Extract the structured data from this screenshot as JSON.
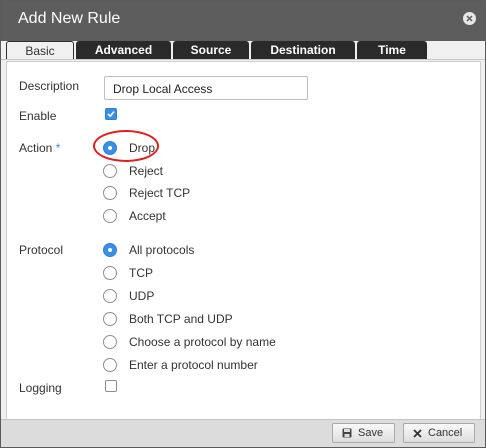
{
  "dialog": {
    "title": "Add New Rule"
  },
  "tabs": [
    {
      "label": "Basic",
      "active": true
    },
    {
      "label": "Advanced",
      "active": false
    },
    {
      "label": "Source",
      "active": false
    },
    {
      "label": "Destination",
      "active": false
    },
    {
      "label": "Time",
      "active": false
    }
  ],
  "form": {
    "description": {
      "label": "Description",
      "value": "Drop Local Access"
    },
    "enable": {
      "label": "Enable",
      "checked": true
    },
    "action": {
      "label": "Action",
      "required_marker": "*",
      "options": [
        {
          "label": "Drop",
          "selected": true
        },
        {
          "label": "Reject",
          "selected": false
        },
        {
          "label": "Reject TCP",
          "selected": false
        },
        {
          "label": "Accept",
          "selected": false
        }
      ]
    },
    "protocol": {
      "label": "Protocol",
      "options": [
        {
          "label": "All protocols",
          "selected": true
        },
        {
          "label": "TCP",
          "selected": false
        },
        {
          "label": "UDP",
          "selected": false
        },
        {
          "label": "Both TCP and UDP",
          "selected": false
        },
        {
          "label": "Choose a protocol by name",
          "selected": false
        },
        {
          "label": "Enter a protocol number",
          "selected": false
        }
      ]
    },
    "logging": {
      "label": "Logging",
      "checked": false
    }
  },
  "footer": {
    "save_label": "Save",
    "cancel_label": "Cancel",
    "save_icon": "floppy-disk-icon",
    "cancel_icon": "x-icon"
  },
  "colors": {
    "titlebar": "#5d5d5d",
    "accent": "#3a8ee6",
    "highlight": "#e02020",
    "tab_dark": "#2a2a2a"
  }
}
